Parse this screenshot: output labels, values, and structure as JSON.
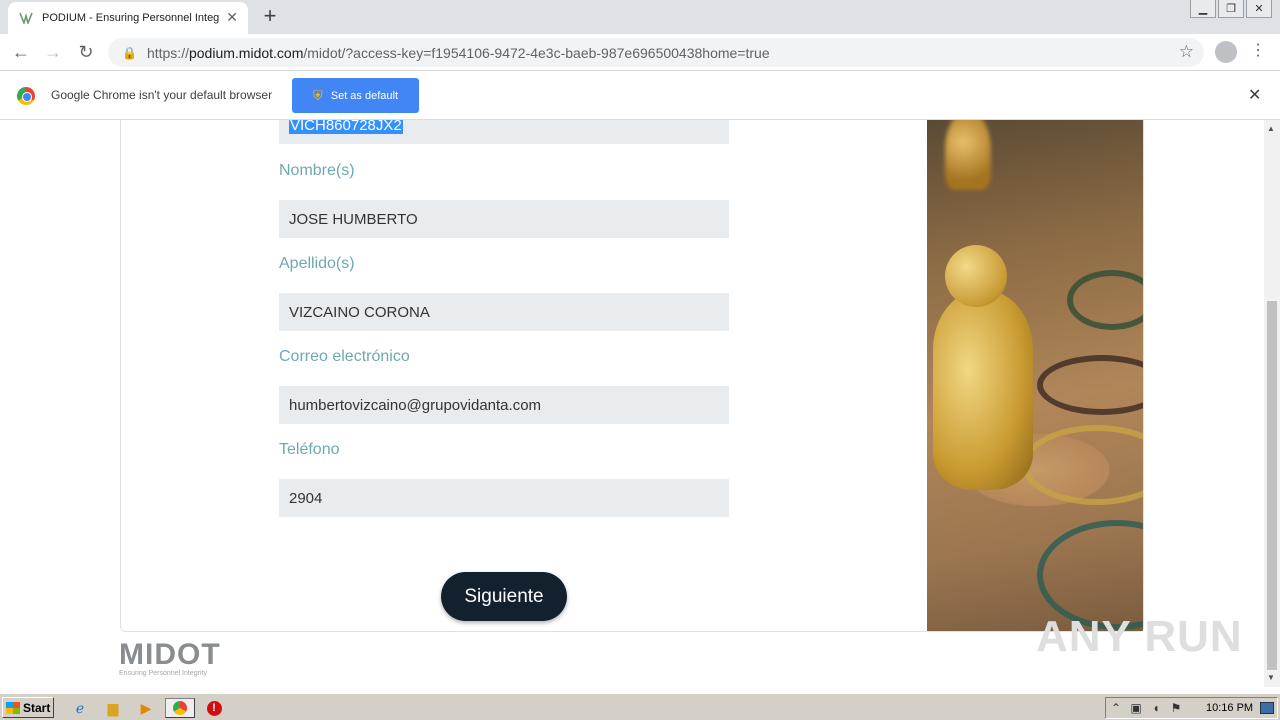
{
  "browser": {
    "tab_title": "PODIUM - Ensuring Personnel Integr",
    "url_scheme": "https://",
    "url_host": "podium.midot.com",
    "url_path": "/midot/?access-key=f1954106-9472-4e3c-baeb-987e696500438home=true"
  },
  "infobar": {
    "message": "Google Chrome isn't your default browser",
    "button_label": "Set as default"
  },
  "form": {
    "rfc_value": "VICH860728JX2",
    "nombre_label": "Nombre(s)",
    "nombre_value": "JOSE HUMBERTO",
    "apellido_label": "Apellido(s)",
    "apellido_value": "VIZCAINO CORONA",
    "correo_label": "Correo electrónico",
    "correo_value": "humbertovizcaino@grupovidanta.com",
    "telefono_label": "Teléfono",
    "telefono_value": "2904",
    "next_button": "Siguiente"
  },
  "logo": {
    "word": "MIDOT",
    "tagline": "Ensuring Personnel Integrity"
  },
  "watermark": "ANY RUN",
  "taskbar": {
    "start_label": "Start",
    "clock": "10:16 PM"
  },
  "colors": {
    "label": "#6fa8b3",
    "input_bg": "#e9ecef",
    "button_bg": "#13202e",
    "infobar_button": "#4285f4"
  }
}
